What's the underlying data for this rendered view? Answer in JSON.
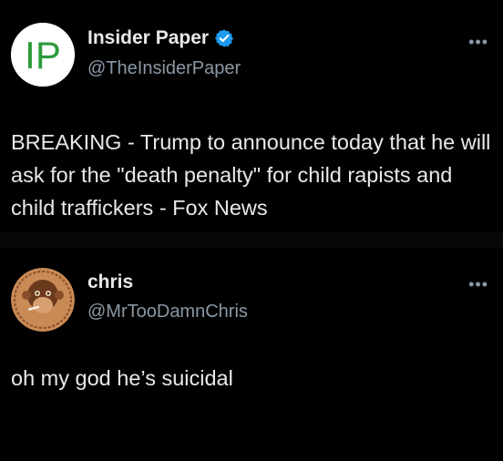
{
  "posts": [
    {
      "display_name": "Insider Paper",
      "handle": "@TheInsiderPaper",
      "verified": true,
      "avatar_text": "IP",
      "more_icon": "more-horizontal-icon",
      "text": "BREAKING - Trump to announce today that he will ask for the \"death penalty\" for child rapists and child traffickers - Fox News"
    },
    {
      "display_name": "chris",
      "handle": "@MrTooDamnChris",
      "verified": false,
      "more_icon": "more-horizontal-icon",
      "text": "oh my god he’s suicidal"
    }
  ],
  "colors": {
    "background": "#000000",
    "text": "#e7e9ea",
    "secondary": "#8b98a5",
    "verified": "#1d9bf0",
    "logo_green": "#2e9a3c"
  }
}
